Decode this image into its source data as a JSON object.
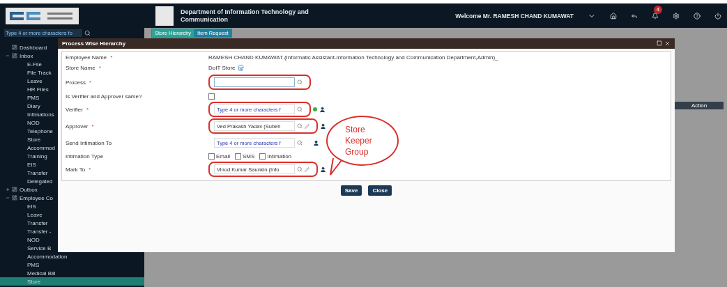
{
  "header": {
    "department": "Department of Information Technology and Communication",
    "welcome": "Welcome Mr. RAMESH CHAND KUMAWAT",
    "notifications": "4"
  },
  "sidebar": {
    "search": {
      "placeholder": "Type 4 or more characters fo"
    },
    "items": [
      {
        "label": "Dashboard"
      },
      {
        "label": "Inbox",
        "expanded": true,
        "children": [
          {
            "label": "E-File"
          },
          {
            "label": "File Track"
          },
          {
            "label": "Leave"
          },
          {
            "label": "HR Files"
          },
          {
            "label": "PMS"
          },
          {
            "label": "Diary"
          },
          {
            "label": "Intimations"
          },
          {
            "label": "NOD"
          },
          {
            "label": "Telephone"
          },
          {
            "label": "Store"
          },
          {
            "label": "Accommod"
          },
          {
            "label": "Training"
          },
          {
            "label": "EIS"
          },
          {
            "label": "Transfer"
          },
          {
            "label": "Delegated"
          }
        ]
      },
      {
        "label": "Outbox",
        "expanded": false
      },
      {
        "label": "Employee Co",
        "expanded": true,
        "children": [
          {
            "label": "EIS",
            "selected": false
          },
          {
            "label": "Leave",
            "selected": false
          },
          {
            "label": "Transfer",
            "selected": false
          },
          {
            "label": "Transfer -",
            "selected": false
          },
          {
            "label": "NOD",
            "selected": false
          },
          {
            "label": "Service B",
            "selected": false
          },
          {
            "label": "Accommodation",
            "selected": false
          },
          {
            "label": "PMS",
            "selected": false
          },
          {
            "label": "Medical Bill",
            "selected": false
          },
          {
            "label": "Store",
            "selected": true
          }
        ]
      }
    ]
  },
  "tabs": [
    {
      "label": "Store Hierarchy",
      "selected": true
    },
    {
      "label": "Item Request",
      "selected": false
    }
  ],
  "background_table": {
    "column": "Action"
  },
  "dialog": {
    "title": "Process Wise Hierarchy",
    "rows": [
      {
        "kind": "text",
        "label": "Employee Name",
        "required_mark": "*",
        "value": "RAMESH CHAND KUMAWAT (Informatic Assistant-Information Technology and Communication Department,Admin)_"
      },
      {
        "kind": "store",
        "label": "Store Name",
        "required_mark": "*",
        "value": "DoIT Store"
      },
      {
        "kind": "input",
        "label": "Process",
        "required_mark": "*",
        "value": "",
        "highlighted": true
      },
      {
        "kind": "checkbox",
        "label": "Is Verifier and Approver same?",
        "checked": false
      },
      {
        "kind": "lookup",
        "label": "Verifier",
        "required_mark": "*",
        "placeholder": "Type 4 or more characters f",
        "highlighted": true,
        "edit": false,
        "status_dot": true
      },
      {
        "kind": "lookup",
        "label": "Approver",
        "required_mark": "*",
        "value": "Ved Prakash Yadav (Suberi",
        "highlighted": true,
        "edit": true,
        "status_dot": false
      },
      {
        "kind": "lookup",
        "label": "Send Intimation To",
        "placeholder": "Type 4 or more characters f",
        "highlighted": false,
        "edit": false,
        "status_dot": false
      },
      {
        "kind": "options",
        "label": "Intimation Type",
        "options": [
          {
            "label": "Email",
            "checked": false
          },
          {
            "label": "SMS",
            "checked": false
          },
          {
            "label": "Intimation",
            "checked": false
          }
        ]
      },
      {
        "kind": "lookup",
        "label": "Mark To",
        "required_mark": "*",
        "value": "Vinod Kumar Saunkin (Info",
        "highlighted": true,
        "edit": true,
        "status_dot": false
      }
    ],
    "buttons": [
      "Save",
      "Close"
    ]
  },
  "callout": {
    "text": "Store Keeper Group"
  }
}
